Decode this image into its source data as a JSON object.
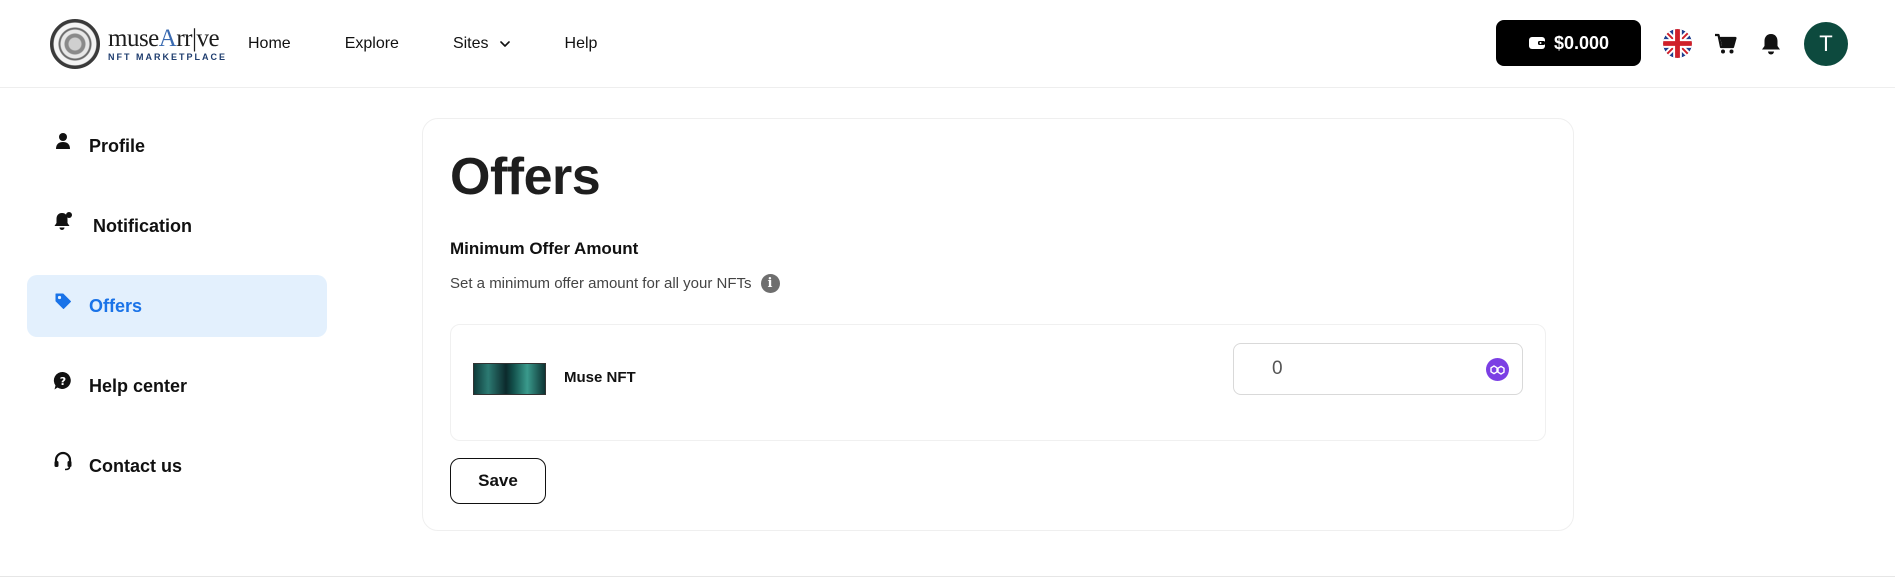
{
  "header": {
    "logo": {
      "word_left": "muse",
      "word_accent": "A",
      "word_right": "rr|ve",
      "sub": "NFT MARKETPLACE"
    },
    "nav": [
      {
        "label": "Home"
      },
      {
        "label": "Explore"
      },
      {
        "label": "Sites",
        "has_dropdown": true
      },
      {
        "label": "Help"
      }
    ],
    "wallet_balance": "$0.000",
    "language_icon": "uk-flag-icon",
    "avatar_initial": "T"
  },
  "sidebar": {
    "items": [
      {
        "label": "Profile",
        "icon": "user-icon",
        "active": false
      },
      {
        "label": "Notification",
        "icon": "bell-icon",
        "active": false
      },
      {
        "label": "Offers",
        "icon": "tag-icon",
        "active": true
      },
      {
        "label": "Help center",
        "icon": "help-bubble-icon",
        "active": false
      },
      {
        "label": "Contact us",
        "icon": "headset-icon",
        "active": false
      }
    ]
  },
  "main": {
    "title": "Offers",
    "section_title": "Minimum Offer Amount",
    "section_desc": "Set a minimum offer amount for all your NFTs",
    "offer": {
      "collection_name": "Muse NFT",
      "amount_value": "0",
      "currency_icon": "polygon-icon"
    },
    "save_label": "Save"
  },
  "colors": {
    "accent": "#1a73e8",
    "active_bg": "#e3f0fd",
    "avatar_bg": "#0d4a3e",
    "polygon": "#7b3fe4"
  }
}
